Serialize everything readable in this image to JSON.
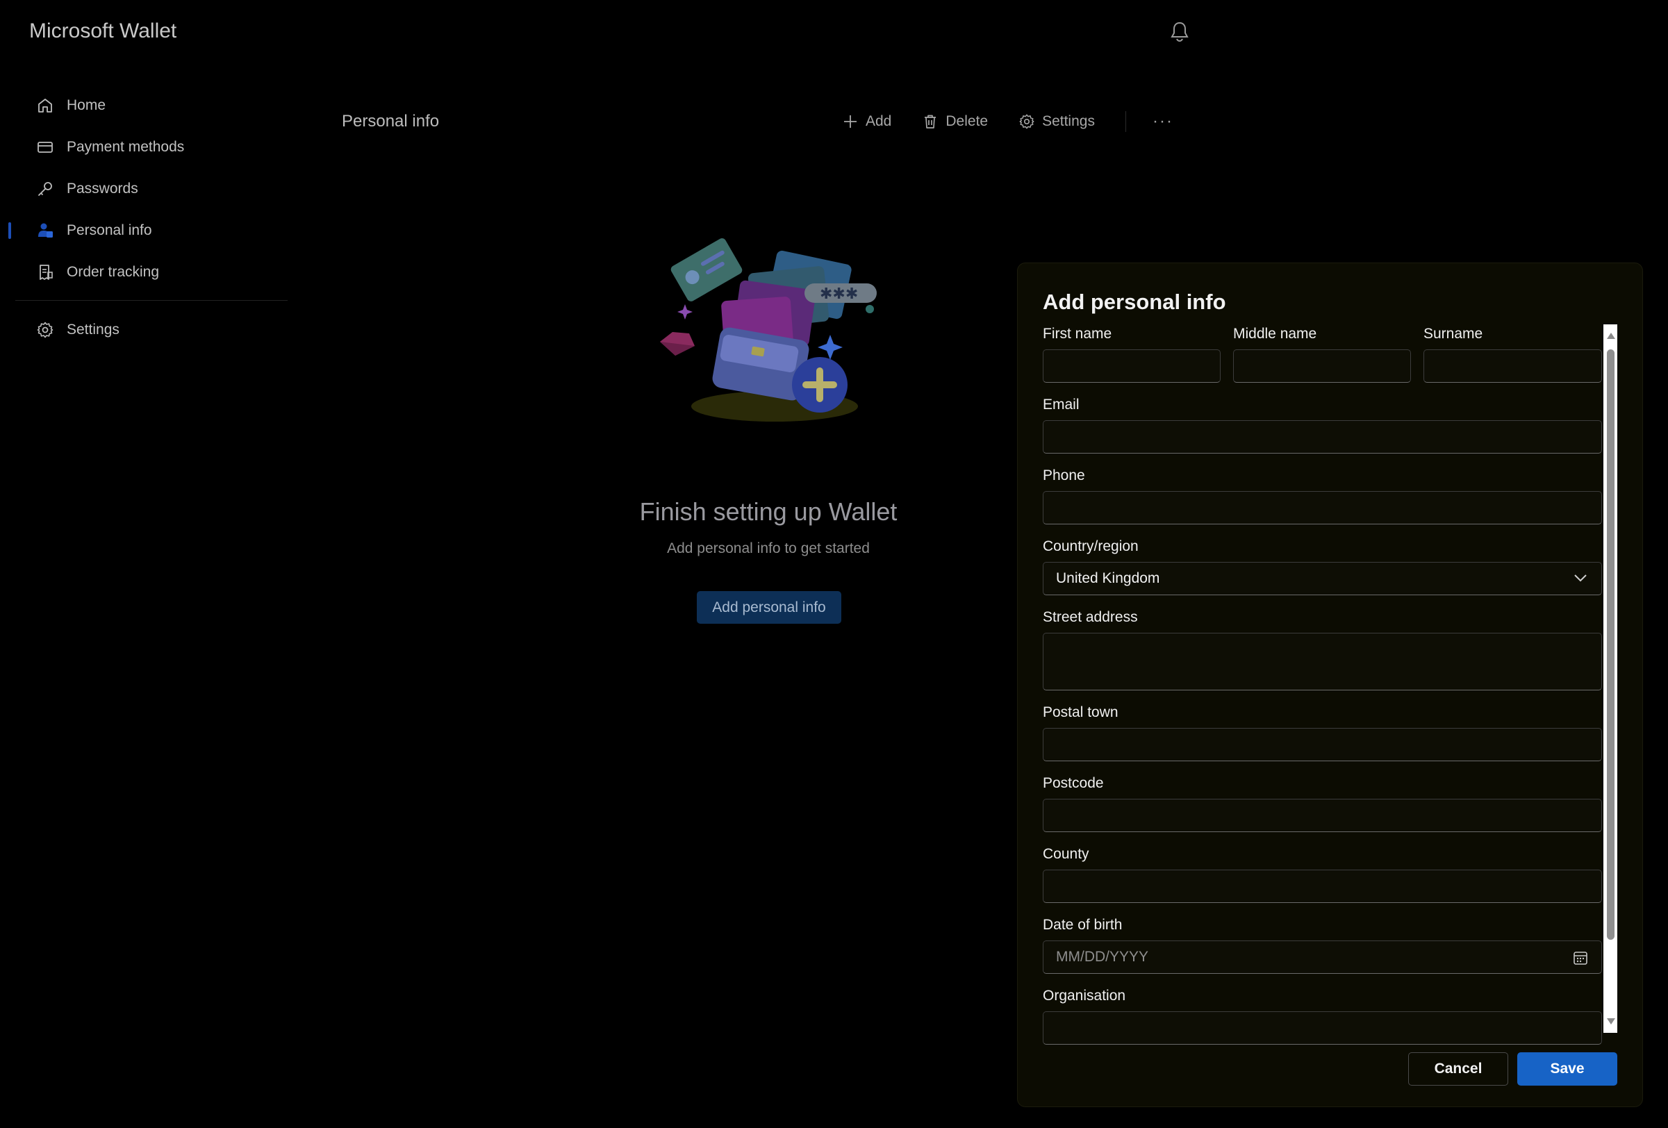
{
  "app": {
    "title": "Microsoft Wallet"
  },
  "sidebar": {
    "items": [
      {
        "label": "Home",
        "icon": "home-icon"
      },
      {
        "label": "Payment methods",
        "icon": "credit-card-icon"
      },
      {
        "label": "Passwords",
        "icon": "key-icon"
      },
      {
        "label": "Personal info",
        "icon": "person-icon",
        "active": true
      },
      {
        "label": "Order tracking",
        "icon": "receipt-icon"
      }
    ],
    "settings": {
      "label": "Settings",
      "icon": "gear-icon"
    }
  },
  "header": {
    "page_title": "Personal info",
    "add_label": "Add",
    "delete_label": "Delete",
    "settings_label": "Settings",
    "more_label": "···"
  },
  "empty_state": {
    "title": "Finish setting up Wallet",
    "subtitle": "Add personal info to get started",
    "button_label": "Add personal info"
  },
  "dialog": {
    "title": "Add personal info",
    "fields": {
      "first_name": {
        "label": "First name",
        "value": ""
      },
      "middle_name": {
        "label": "Middle name",
        "value": ""
      },
      "surname": {
        "label": "Surname",
        "value": ""
      },
      "email": {
        "label": "Email",
        "value": ""
      },
      "phone": {
        "label": "Phone",
        "value": ""
      },
      "country": {
        "label": "Country/region",
        "value": "United Kingdom"
      },
      "street": {
        "label": "Street address",
        "value": ""
      },
      "postal_town": {
        "label": "Postal town",
        "value": ""
      },
      "postcode": {
        "label": "Postcode",
        "value": ""
      },
      "county": {
        "label": "County",
        "value": ""
      },
      "dob": {
        "label": "Date of birth",
        "placeholder": "MM/DD/YYYY"
      },
      "organisation": {
        "label": "Organisation",
        "value": ""
      }
    },
    "cancel_label": "Cancel",
    "save_label": "Save"
  },
  "colors": {
    "accent": "#1763c6",
    "dialog_bg": "#0c0c02",
    "nav_indicator": "#1d4fb8"
  }
}
